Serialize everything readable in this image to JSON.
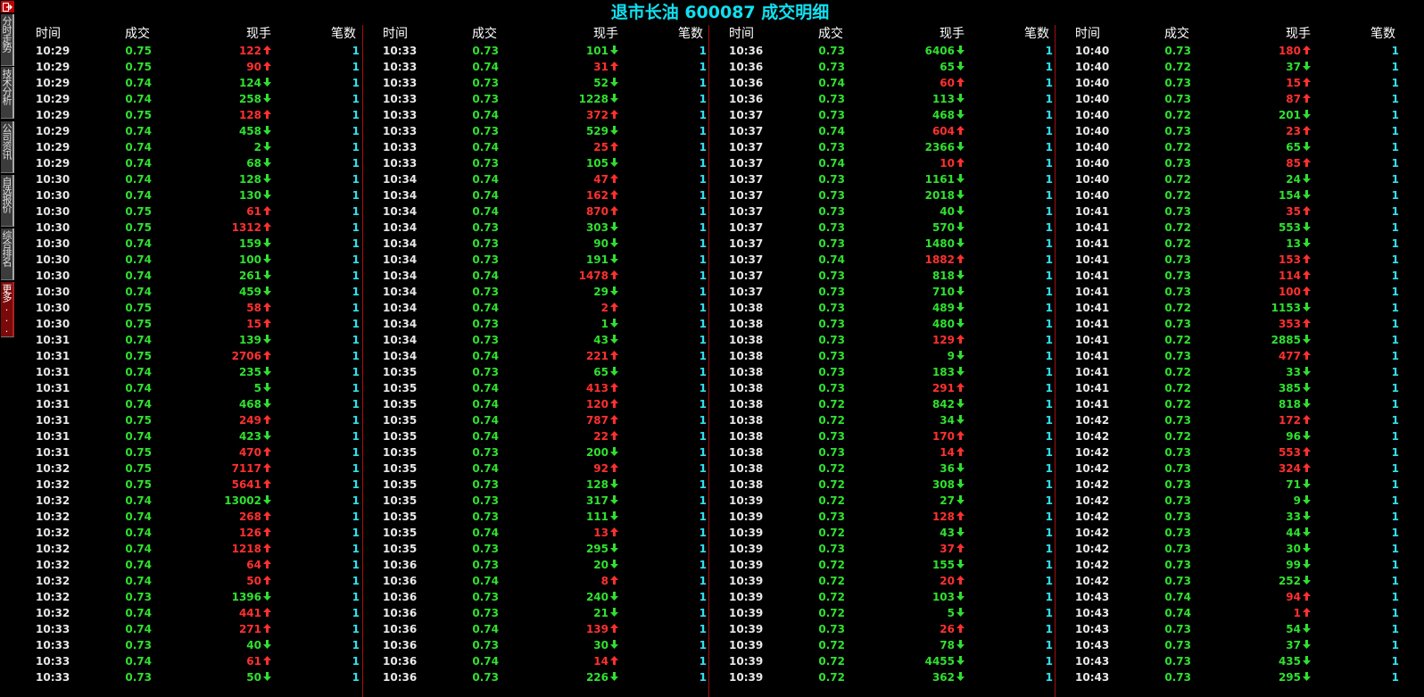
{
  "title": "退市长油 600087 成交明细",
  "side_top_icon": "exit-icon",
  "side_tabs": [
    {
      "label": "分时走势",
      "key": "intraday"
    },
    {
      "label": "技术分析",
      "key": "technical"
    },
    {
      "label": "公司资讯",
      "key": "company"
    },
    {
      "label": "自选报价",
      "key": "watchlist"
    },
    {
      "label": "综合排名",
      "key": "ranking"
    },
    {
      "label": "更多...",
      "key": "more"
    }
  ],
  "headers": [
    "时间",
    "成交",
    "现手",
    "笔数"
  ],
  "colors": {
    "up": "#ff3030",
    "down": "#30e030",
    "title": "#10e0f0",
    "count": "#30e0f0",
    "divider": "#a01010"
  },
  "columns": [
    [
      [
        "10:29",
        "0.75",
        "122",
        "up",
        "1"
      ],
      [
        "10:29",
        "0.75",
        "90",
        "up",
        "1"
      ],
      [
        "10:29",
        "0.74",
        "124",
        "down",
        "1"
      ],
      [
        "10:29",
        "0.74",
        "258",
        "down",
        "1"
      ],
      [
        "10:29",
        "0.75",
        "128",
        "up",
        "1"
      ],
      [
        "10:29",
        "0.74",
        "458",
        "down",
        "1"
      ],
      [
        "10:29",
        "0.74",
        "2",
        "down",
        "1"
      ],
      [
        "10:29",
        "0.74",
        "68",
        "down",
        "1"
      ],
      [
        "10:30",
        "0.74",
        "128",
        "down",
        "1"
      ],
      [
        "10:30",
        "0.74",
        "130",
        "down",
        "1"
      ],
      [
        "10:30",
        "0.75",
        "61",
        "up",
        "1"
      ],
      [
        "10:30",
        "0.75",
        "1312",
        "up",
        "1"
      ],
      [
        "10:30",
        "0.74",
        "159",
        "down",
        "1"
      ],
      [
        "10:30",
        "0.74",
        "100",
        "down",
        "1"
      ],
      [
        "10:30",
        "0.74",
        "261",
        "down",
        "1"
      ],
      [
        "10:30",
        "0.74",
        "459",
        "down",
        "1"
      ],
      [
        "10:30",
        "0.75",
        "58",
        "up",
        "1"
      ],
      [
        "10:30",
        "0.75",
        "15",
        "up",
        "1"
      ],
      [
        "10:31",
        "0.74",
        "139",
        "down",
        "1"
      ],
      [
        "10:31",
        "0.75",
        "2706",
        "up",
        "1"
      ],
      [
        "10:31",
        "0.74",
        "235",
        "down",
        "1"
      ],
      [
        "10:31",
        "0.74",
        "5",
        "down",
        "1"
      ],
      [
        "10:31",
        "0.74",
        "468",
        "down",
        "1"
      ],
      [
        "10:31",
        "0.75",
        "249",
        "up",
        "1"
      ],
      [
        "10:31",
        "0.74",
        "423",
        "down",
        "1"
      ],
      [
        "10:31",
        "0.75",
        "470",
        "up",
        "1"
      ],
      [
        "10:32",
        "0.75",
        "7117",
        "up",
        "1"
      ],
      [
        "10:32",
        "0.75",
        "5641",
        "up",
        "1"
      ],
      [
        "10:32",
        "0.74",
        "13002",
        "down",
        "1"
      ],
      [
        "10:32",
        "0.74",
        "268",
        "up",
        "1"
      ],
      [
        "10:32",
        "0.74",
        "126",
        "up",
        "1"
      ],
      [
        "10:32",
        "0.74",
        "1218",
        "up",
        "1"
      ],
      [
        "10:32",
        "0.74",
        "64",
        "up",
        "1"
      ],
      [
        "10:32",
        "0.74",
        "50",
        "up",
        "1"
      ],
      [
        "10:32",
        "0.73",
        "1396",
        "down",
        "1"
      ],
      [
        "10:32",
        "0.74",
        "441",
        "up",
        "1"
      ],
      [
        "10:33",
        "0.74",
        "271",
        "up",
        "1"
      ],
      [
        "10:33",
        "0.73",
        "40",
        "down",
        "1"
      ],
      [
        "10:33",
        "0.74",
        "61",
        "up",
        "1"
      ],
      [
        "10:33",
        "0.73",
        "50",
        "down",
        "1"
      ]
    ],
    [
      [
        "10:33",
        "0.73",
        "101",
        "down",
        "1"
      ],
      [
        "10:33",
        "0.74",
        "31",
        "up",
        "1"
      ],
      [
        "10:33",
        "0.73",
        "52",
        "down",
        "1"
      ],
      [
        "10:33",
        "0.73",
        "1228",
        "down",
        "1"
      ],
      [
        "10:33",
        "0.74",
        "372",
        "up",
        "1"
      ],
      [
        "10:33",
        "0.73",
        "529",
        "down",
        "1"
      ],
      [
        "10:33",
        "0.74",
        "25",
        "up",
        "1"
      ],
      [
        "10:33",
        "0.73",
        "105",
        "down",
        "1"
      ],
      [
        "10:34",
        "0.74",
        "47",
        "up",
        "1"
      ],
      [
        "10:34",
        "0.74",
        "162",
        "up",
        "1"
      ],
      [
        "10:34",
        "0.74",
        "870",
        "up",
        "1"
      ],
      [
        "10:34",
        "0.73",
        "303",
        "down",
        "1"
      ],
      [
        "10:34",
        "0.73",
        "90",
        "down",
        "1"
      ],
      [
        "10:34",
        "0.73",
        "191",
        "down",
        "1"
      ],
      [
        "10:34",
        "0.74",
        "1478",
        "up",
        "1"
      ],
      [
        "10:34",
        "0.73",
        "29",
        "down",
        "1"
      ],
      [
        "10:34",
        "0.74",
        "2",
        "up",
        "1"
      ],
      [
        "10:34",
        "0.73",
        "1",
        "down",
        "1"
      ],
      [
        "10:34",
        "0.73",
        "43",
        "down",
        "1"
      ],
      [
        "10:34",
        "0.74",
        "221",
        "up",
        "1"
      ],
      [
        "10:35",
        "0.73",
        "65",
        "down",
        "1"
      ],
      [
        "10:35",
        "0.74",
        "413",
        "up",
        "1"
      ],
      [
        "10:35",
        "0.74",
        "120",
        "up",
        "1"
      ],
      [
        "10:35",
        "0.74",
        "787",
        "up",
        "1"
      ],
      [
        "10:35",
        "0.74",
        "22",
        "up",
        "1"
      ],
      [
        "10:35",
        "0.73",
        "200",
        "down",
        "1"
      ],
      [
        "10:35",
        "0.74",
        "92",
        "up",
        "1"
      ],
      [
        "10:35",
        "0.73",
        "128",
        "down",
        "1"
      ],
      [
        "10:35",
        "0.73",
        "317",
        "down",
        "1"
      ],
      [
        "10:35",
        "0.73",
        "111",
        "down",
        "1"
      ],
      [
        "10:35",
        "0.74",
        "13",
        "up",
        "1"
      ],
      [
        "10:35",
        "0.73",
        "295",
        "down",
        "1"
      ],
      [
        "10:36",
        "0.73",
        "20",
        "down",
        "1"
      ],
      [
        "10:36",
        "0.74",
        "8",
        "up",
        "1"
      ],
      [
        "10:36",
        "0.73",
        "240",
        "down",
        "1"
      ],
      [
        "10:36",
        "0.73",
        "21",
        "down",
        "1"
      ],
      [
        "10:36",
        "0.74",
        "139",
        "up",
        "1"
      ],
      [
        "10:36",
        "0.73",
        "30",
        "down",
        "1"
      ],
      [
        "10:36",
        "0.74",
        "14",
        "up",
        "1"
      ],
      [
        "10:36",
        "0.73",
        "226",
        "down",
        "1"
      ]
    ],
    [
      [
        "10:36",
        "0.73",
        "6406",
        "down",
        "1"
      ],
      [
        "10:36",
        "0.73",
        "65",
        "down",
        "1"
      ],
      [
        "10:36",
        "0.74",
        "60",
        "up",
        "1"
      ],
      [
        "10:36",
        "0.73",
        "113",
        "down",
        "1"
      ],
      [
        "10:37",
        "0.73",
        "468",
        "down",
        "1"
      ],
      [
        "10:37",
        "0.74",
        "604",
        "up",
        "1"
      ],
      [
        "10:37",
        "0.73",
        "2366",
        "down",
        "1"
      ],
      [
        "10:37",
        "0.74",
        "10",
        "up",
        "1"
      ],
      [
        "10:37",
        "0.73",
        "1161",
        "down",
        "1"
      ],
      [
        "10:37",
        "0.73",
        "2018",
        "down",
        "1"
      ],
      [
        "10:37",
        "0.73",
        "40",
        "down",
        "1"
      ],
      [
        "10:37",
        "0.73",
        "570",
        "down",
        "1"
      ],
      [
        "10:37",
        "0.73",
        "1480",
        "down",
        "1"
      ],
      [
        "10:37",
        "0.74",
        "1882",
        "up",
        "1"
      ],
      [
        "10:37",
        "0.73",
        "818",
        "down",
        "1"
      ],
      [
        "10:37",
        "0.73",
        "710",
        "down",
        "1"
      ],
      [
        "10:38",
        "0.73",
        "489",
        "down",
        "1"
      ],
      [
        "10:38",
        "0.73",
        "480",
        "down",
        "1"
      ],
      [
        "10:38",
        "0.73",
        "129",
        "up",
        "1"
      ],
      [
        "10:38",
        "0.73",
        "9",
        "down",
        "1"
      ],
      [
        "10:38",
        "0.73",
        "183",
        "down",
        "1"
      ],
      [
        "10:38",
        "0.73",
        "291",
        "up",
        "1"
      ],
      [
        "10:38",
        "0.72",
        "842",
        "down",
        "1"
      ],
      [
        "10:38",
        "0.72",
        "34",
        "down",
        "1"
      ],
      [
        "10:38",
        "0.73",
        "170",
        "up",
        "1"
      ],
      [
        "10:38",
        "0.73",
        "14",
        "up",
        "1"
      ],
      [
        "10:38",
        "0.72",
        "36",
        "down",
        "1"
      ],
      [
        "10:38",
        "0.72",
        "308",
        "down",
        "1"
      ],
      [
        "10:39",
        "0.72",
        "27",
        "down",
        "1"
      ],
      [
        "10:39",
        "0.73",
        "128",
        "up",
        "1"
      ],
      [
        "10:39",
        "0.72",
        "43",
        "down",
        "1"
      ],
      [
        "10:39",
        "0.73",
        "37",
        "up",
        "1"
      ],
      [
        "10:39",
        "0.72",
        "155",
        "down",
        "1"
      ],
      [
        "10:39",
        "0.72",
        "20",
        "up",
        "1"
      ],
      [
        "10:39",
        "0.72",
        "103",
        "down",
        "1"
      ],
      [
        "10:39",
        "0.72",
        "5",
        "down",
        "1"
      ],
      [
        "10:39",
        "0.73",
        "26",
        "up",
        "1"
      ],
      [
        "10:39",
        "0.72",
        "78",
        "down",
        "1"
      ],
      [
        "10:39",
        "0.72",
        "4455",
        "down",
        "1"
      ],
      [
        "10:39",
        "0.72",
        "362",
        "down",
        "1"
      ]
    ],
    [
      [
        "10:40",
        "0.73",
        "180",
        "up",
        "1"
      ],
      [
        "10:40",
        "0.72",
        "37",
        "down",
        "1"
      ],
      [
        "10:40",
        "0.73",
        "15",
        "up",
        "1"
      ],
      [
        "10:40",
        "0.73",
        "87",
        "up",
        "1"
      ],
      [
        "10:40",
        "0.72",
        "201",
        "down",
        "1"
      ],
      [
        "10:40",
        "0.73",
        "23",
        "up",
        "1"
      ],
      [
        "10:40",
        "0.72",
        "65",
        "down",
        "1"
      ],
      [
        "10:40",
        "0.73",
        "85",
        "up",
        "1"
      ],
      [
        "10:40",
        "0.72",
        "24",
        "down",
        "1"
      ],
      [
        "10:40",
        "0.72",
        "154",
        "down",
        "1"
      ],
      [
        "10:41",
        "0.73",
        "35",
        "up",
        "1"
      ],
      [
        "10:41",
        "0.72",
        "553",
        "down",
        "1"
      ],
      [
        "10:41",
        "0.72",
        "13",
        "down",
        "1"
      ],
      [
        "10:41",
        "0.73",
        "153",
        "up",
        "1"
      ],
      [
        "10:41",
        "0.73",
        "114",
        "up",
        "1"
      ],
      [
        "10:41",
        "0.73",
        "100",
        "up",
        "1"
      ],
      [
        "10:41",
        "0.72",
        "1153",
        "down",
        "1"
      ],
      [
        "10:41",
        "0.73",
        "353",
        "up",
        "1"
      ],
      [
        "10:41",
        "0.72",
        "2885",
        "down",
        "1"
      ],
      [
        "10:41",
        "0.73",
        "477",
        "up",
        "1"
      ],
      [
        "10:41",
        "0.72",
        "33",
        "down",
        "1"
      ],
      [
        "10:41",
        "0.72",
        "385",
        "down",
        "1"
      ],
      [
        "10:41",
        "0.72",
        "818",
        "down",
        "1"
      ],
      [
        "10:42",
        "0.73",
        "172",
        "up",
        "1"
      ],
      [
        "10:42",
        "0.72",
        "96",
        "down",
        "1"
      ],
      [
        "10:42",
        "0.73",
        "553",
        "up",
        "1"
      ],
      [
        "10:42",
        "0.73",
        "324",
        "up",
        "1"
      ],
      [
        "10:42",
        "0.73",
        "71",
        "down",
        "1"
      ],
      [
        "10:42",
        "0.73",
        "9",
        "down",
        "1"
      ],
      [
        "10:42",
        "0.73",
        "33",
        "down",
        "1"
      ],
      [
        "10:42",
        "0.73",
        "44",
        "down",
        "1"
      ],
      [
        "10:42",
        "0.73",
        "30",
        "down",
        "1"
      ],
      [
        "10:42",
        "0.73",
        "99",
        "down",
        "1"
      ],
      [
        "10:42",
        "0.73",
        "252",
        "down",
        "1"
      ],
      [
        "10:43",
        "0.74",
        "94",
        "up",
        "1"
      ],
      [
        "10:43",
        "0.74",
        "1",
        "up",
        "1"
      ],
      [
        "10:43",
        "0.73",
        "54",
        "down",
        "1"
      ],
      [
        "10:43",
        "0.73",
        "37",
        "down",
        "1"
      ],
      [
        "10:43",
        "0.73",
        "435",
        "down",
        "1"
      ],
      [
        "10:43",
        "0.73",
        "295",
        "down",
        "1"
      ]
    ]
  ]
}
